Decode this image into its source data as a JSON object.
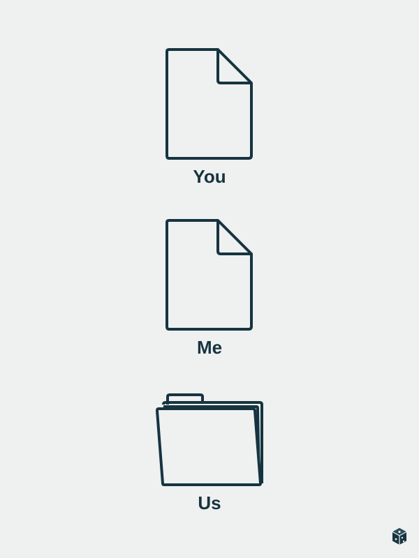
{
  "colors": {
    "background": "#eff0f0",
    "ink": "#163440"
  },
  "items": [
    {
      "label": "You",
      "icon": "document-icon"
    },
    {
      "label": "Me",
      "icon": "document-icon"
    },
    {
      "label": "Us",
      "icon": "folder-icon"
    }
  ],
  "corner_logo": {
    "icon": "cube-logo-icon"
  }
}
